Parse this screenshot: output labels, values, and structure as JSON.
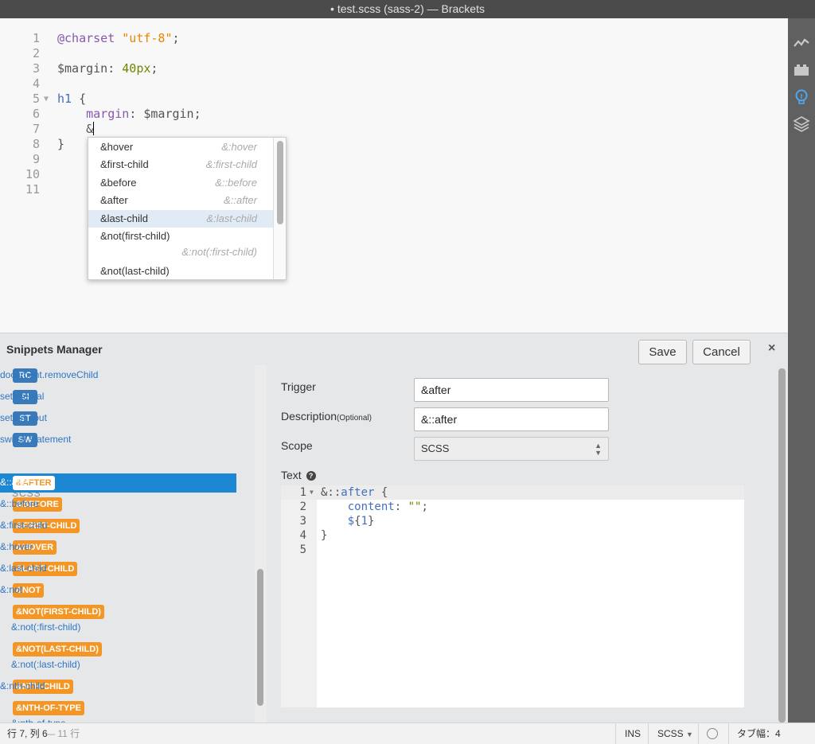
{
  "window": {
    "title": "• test.scss (sass-2) — Brackets"
  },
  "right_toolbar": {
    "icons": [
      "live-preview-icon",
      "extension-manager-icon",
      "lightbulb-icon",
      "layers-icon"
    ]
  },
  "editor": {
    "lines": [
      {
        "num": "1",
        "tokens": [
          {
            "t": "@charset",
            "c": "k-purple"
          },
          {
            "t": " ",
            "c": ""
          },
          {
            "t": "\"utf-8\"",
            "c": "k-orange"
          },
          {
            "t": ";",
            "c": "k-dark"
          }
        ]
      },
      {
        "num": "2",
        "tokens": []
      },
      {
        "num": "3",
        "tokens": [
          {
            "t": "$margin: ",
            "c": "k-dark"
          },
          {
            "t": "40px",
            "c": "k-green"
          },
          {
            "t": ";",
            "c": "k-dark"
          }
        ]
      },
      {
        "num": "4",
        "tokens": []
      },
      {
        "num": "5",
        "tokens": [
          {
            "t": "h1",
            "c": "k-blue"
          },
          {
            "t": " {",
            "c": "k-dark"
          }
        ]
      },
      {
        "num": "6",
        "tokens": [
          {
            "t": "    margin",
            "c": "k-purple"
          },
          {
            "t": ": $margin;",
            "c": "k-dark"
          }
        ]
      },
      {
        "num": "7",
        "tokens": [
          {
            "t": "    &",
            "c": "k-dark"
          }
        ]
      },
      {
        "num": "8",
        "tokens": [
          {
            "t": "}",
            "c": "k-dark"
          }
        ]
      },
      {
        "num": "9",
        "tokens": []
      },
      {
        "num": "10",
        "tokens": []
      },
      {
        "num": "11",
        "tokens": []
      }
    ]
  },
  "hints": {
    "items": [
      {
        "label": "&hover",
        "detail": "&:hover"
      },
      {
        "label": "&first-child",
        "detail": "&:first-child"
      },
      {
        "label": "&before",
        "detail": "&::before"
      },
      {
        "label": "&after",
        "detail": "&::after"
      },
      {
        "label": "&last-child",
        "detail": "&:last-child",
        "selected": true
      },
      {
        "label": "&not(first-child)",
        "detail": "&:not(:first-child)"
      },
      {
        "label": "&not(last-child)",
        "detail": ""
      }
    ]
  },
  "panel": {
    "title": "Snippets Manager",
    "save_label": "Save",
    "cancel_label": "Cancel",
    "close_label": "×"
  },
  "snippet_list": {
    "js_items": [
      {
        "badge": "RC",
        "desc": "document.removeChild"
      },
      {
        "badge": "SI",
        "desc": "setInterval"
      },
      {
        "badge": "ST",
        "desc": "setTimeout"
      },
      {
        "badge": "SW",
        "desc": "switch statement"
      }
    ],
    "section": "SCSS",
    "scss_items": [
      {
        "badge": "&AFTER",
        "desc": "&::after",
        "selected": true
      },
      {
        "badge": "&BEFORE",
        "desc": "&::before"
      },
      {
        "badge": "&FIRST-CHILD",
        "desc": "&:first-child"
      },
      {
        "badge": "&HOVER",
        "desc": "&:hover"
      },
      {
        "badge": "&LAST-CHILD",
        "desc": "&:last-child"
      },
      {
        "badge": "&NOT",
        "desc": "&:not"
      },
      {
        "badge": "&NOT(FIRST-CHILD)",
        "desc": "&:not(:first-child)",
        "wrap": true
      },
      {
        "badge": "&NOT(LAST-CHILD)",
        "desc": "&:not(:last-child)",
        "wrap": true
      },
      {
        "badge": "&NTH-CHILD",
        "desc": "&:nth-child"
      },
      {
        "badge": "&NTH-OF-TYPE",
        "desc": "&:nth-of-type",
        "wrap": true
      }
    ]
  },
  "form": {
    "trigger_label": "Trigger",
    "trigger_value": "&after",
    "description_label": "Description",
    "description_optional": "(Optional)",
    "description_value": "&::after",
    "scope_label": "Scope",
    "scope_value": "SCSS",
    "text_label": "Text",
    "help_glyph": "?"
  },
  "snippet_code": {
    "lines": [
      {
        "num": "1",
        "tokens": [
          {
            "t": "&::",
            "c": "k-dark"
          },
          {
            "t": "after",
            "c": "k-blue"
          },
          {
            "t": " {",
            "c": "k-dark"
          }
        ]
      },
      {
        "num": "2",
        "tokens": [
          {
            "t": "    content",
            "c": "k-blue"
          },
          {
            "t": ": ",
            "c": "k-dark"
          },
          {
            "t": "\"\"",
            "c": "k-green"
          },
          {
            "t": ";",
            "c": "k-dark"
          }
        ]
      },
      {
        "num": "3",
        "tokens": [
          {
            "t": "    $",
            "c": "k-blue"
          },
          {
            "t": "{",
            "c": "k-dark"
          },
          {
            "t": "1",
            "c": "k-blue"
          },
          {
            "t": "}",
            "c": "k-dark"
          }
        ]
      },
      {
        "num": "4",
        "tokens": [
          {
            "t": "}",
            "c": "k-dark"
          }
        ]
      },
      {
        "num": "5",
        "tokens": []
      }
    ]
  },
  "statusbar": {
    "cursor": "行 7, 列 6",
    "lines": " — 11 行",
    "mode": "INS",
    "language": "SCSS",
    "tab_size": "タブ幅：4"
  }
}
